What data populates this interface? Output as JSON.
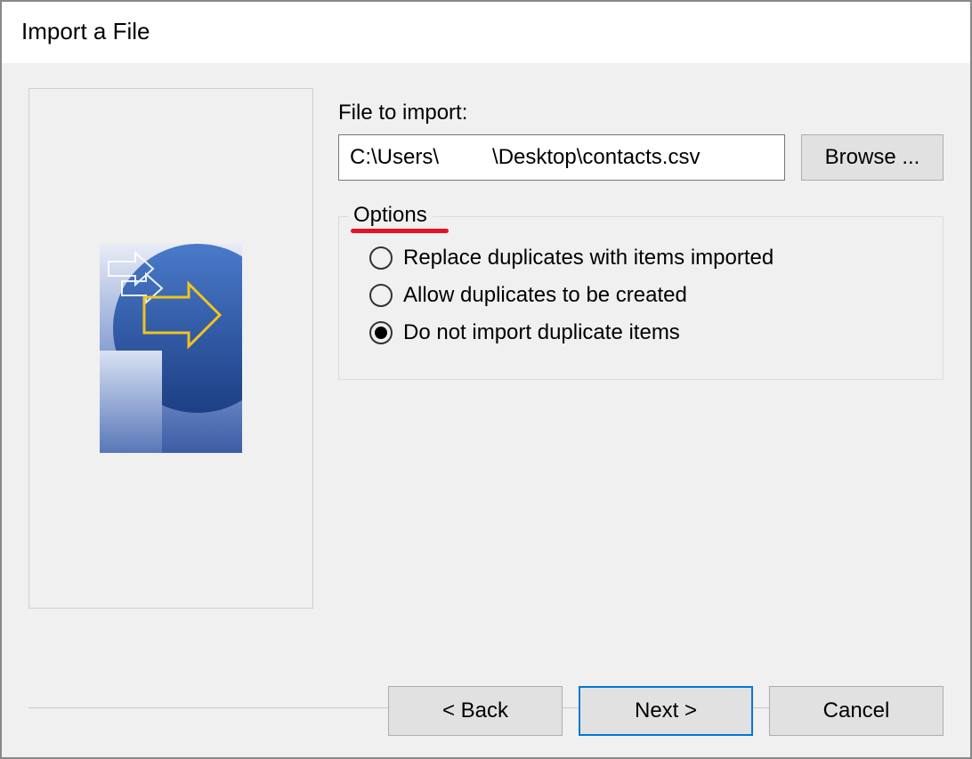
{
  "dialog": {
    "title": "Import a File"
  },
  "file": {
    "label": "File to import:",
    "value": "C:\\Users\\         \\Desktop\\contacts.csv",
    "browse_label": "Browse ..."
  },
  "options": {
    "legend": "Options",
    "items": [
      {
        "label": "Replace duplicates with items imported",
        "selected": false
      },
      {
        "label": "Allow duplicates to be created",
        "selected": false
      },
      {
        "label": "Do not import duplicate items",
        "selected": true
      }
    ]
  },
  "buttons": {
    "back": "< Back",
    "next": "Next >",
    "cancel": "Cancel"
  },
  "annotation": {
    "underline_color": "#e81123"
  }
}
